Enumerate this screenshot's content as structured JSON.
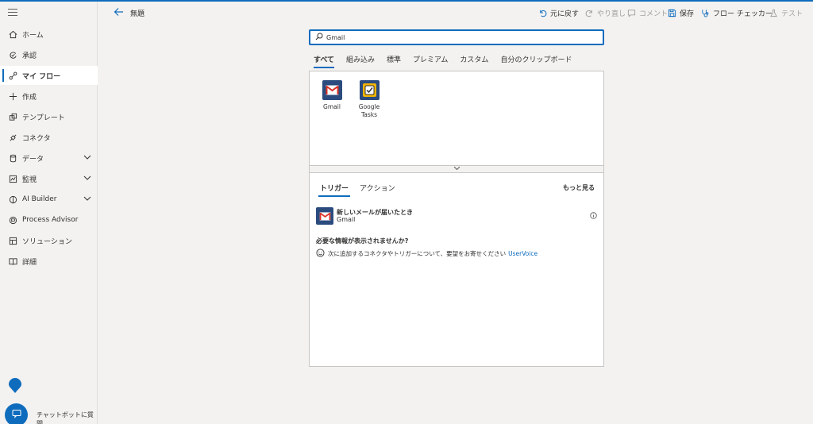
{
  "sidebar": {
    "items": [
      {
        "label": "ホーム",
        "icon": "home-icon"
      },
      {
        "label": "承認",
        "icon": "approvals-icon"
      },
      {
        "label": "マイ フロー",
        "icon": "flow-icon",
        "active": true
      },
      {
        "label": "作成",
        "icon": "plus-icon"
      },
      {
        "label": "テンプレート",
        "icon": "template-icon"
      },
      {
        "label": "コネクタ",
        "icon": "connector-icon"
      },
      {
        "label": "データ",
        "icon": "database-icon",
        "expandable": true
      },
      {
        "label": "監視",
        "icon": "monitor-icon",
        "expandable": true
      },
      {
        "label": "AI Builder",
        "icon": "ai-builder-icon",
        "expandable": true
      },
      {
        "label": "Process Advisor",
        "icon": "process-advisor-icon"
      },
      {
        "label": "ソリューション",
        "icon": "solutions-icon"
      },
      {
        "label": "詳細",
        "icon": "book-icon"
      }
    ],
    "chatbot_label": "チャットボットに質問"
  },
  "header": {
    "title": "無題",
    "undo": "元に戻す",
    "redo": "やり直し",
    "comment": "コメント",
    "save": "保存",
    "checker": "フロー チェッカー",
    "test": "テスト"
  },
  "search": {
    "value": "Gmail"
  },
  "tabs": [
    "すべて",
    "組み込み",
    "標準",
    "プレミアム",
    "カスタム",
    "自分のクリップボード"
  ],
  "connectors": [
    {
      "name": "Gmail",
      "icon": "gmail-icon",
      "color": "#2b4b7e"
    },
    {
      "name": "Google Tasks",
      "icon": "google-tasks-icon",
      "color": "#f4b400"
    }
  ],
  "subtabs": [
    "トリガー",
    "アクション"
  ],
  "more_label": "もっと見る",
  "trigger": {
    "title": "新しいメールが届いたとき",
    "connector": "Gmail"
  },
  "missing_title": "必要な情報が表示されませんか?",
  "feedback": {
    "text": "次に追加するコネクタやトリガーについて、要望をお寄せください",
    "link": "UserVoice"
  },
  "colors": {
    "accent": "#0f6cbd",
    "gmail_tile": "#2b4b7e",
    "tasks_tile": "#f4b400"
  }
}
